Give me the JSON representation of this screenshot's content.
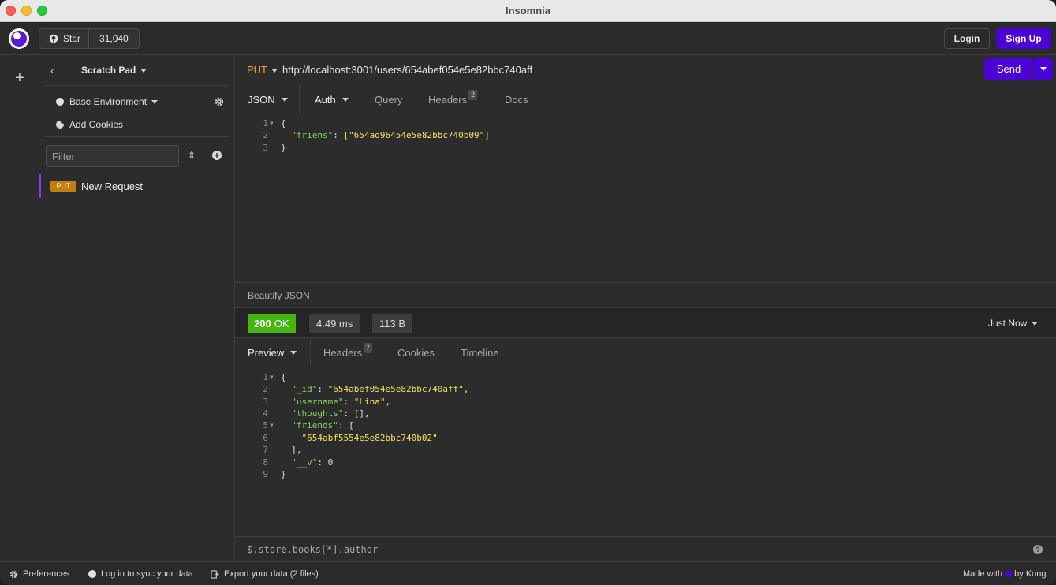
{
  "window": {
    "title": "Insomnia"
  },
  "appbar": {
    "star_label": "Star",
    "star_count": "31,040",
    "login_label": "Login",
    "signup_label": "Sign Up",
    "accent_color": "#4b00d4"
  },
  "sidebar": {
    "project_title": "Scratch Pad",
    "environment": "Base Environment",
    "cookies_label": "Add Cookies",
    "filter_placeholder": "Filter",
    "requests": [
      {
        "method": "PUT",
        "name": "New Request"
      }
    ]
  },
  "request": {
    "method": "PUT",
    "method_color": "#f7a13a",
    "url": "http://localhost:3001/users/654abef054e5e82bbc740aff",
    "send_label": "Send",
    "tabs": [
      {
        "label": "JSON",
        "active": true
      },
      {
        "label": "Auth"
      },
      {
        "label": "Query"
      },
      {
        "label": "Headers",
        "count": "2"
      },
      {
        "label": "Docs"
      }
    ],
    "body_lines": [
      {
        "ln": "1",
        "text": "{"
      },
      {
        "ln": "2",
        "key": "\"friens\"",
        "value": "[\"654ad96454e5e82bbc740b09\"]"
      },
      {
        "ln": "3",
        "text": "}"
      }
    ],
    "beautify_label": "Beautify JSON"
  },
  "response": {
    "status_code": "200",
    "status_text": "OK",
    "status_color": "#44b611",
    "time": "4.49 ms",
    "size": "113 B",
    "history_label": "Just Now",
    "tabs": [
      {
        "label": "Preview",
        "active": true
      },
      {
        "label": "Headers",
        "count": "7"
      },
      {
        "label": "Cookies"
      },
      {
        "label": "Timeline"
      }
    ],
    "body_lines": [
      {
        "ln": "1",
        "text": "{"
      },
      {
        "ln": "2",
        "key": "\"_id\"",
        "value": "\"654abef054e5e82bbc740aff\","
      },
      {
        "ln": "3",
        "key": "\"username\"",
        "value": "\"Lina\","
      },
      {
        "ln": "4",
        "key": "\"thoughts\"",
        "value": "[],"
      },
      {
        "ln": "5",
        "key": "\"friends\"",
        "value": "["
      },
      {
        "ln": "6",
        "value": "\"654abf5554e5e82bbc740b02\""
      },
      {
        "ln": "7",
        "text": "],"
      },
      {
        "ln": "8",
        "key": "\"__v\"",
        "value": "0"
      },
      {
        "ln": "9",
        "text": "}"
      }
    ],
    "filter_placeholder": "$.store.books[*].author"
  },
  "footer": {
    "preferences": "Preferences",
    "sync": "Log in to sync your data",
    "export": "Export your data (2 files)",
    "made_with": "Made with",
    "by": "by Kong"
  }
}
